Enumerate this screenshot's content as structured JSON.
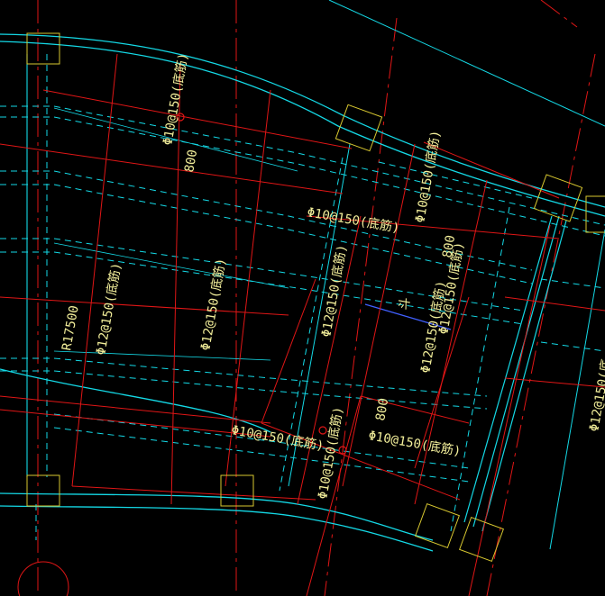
{
  "drawing": {
    "background": "#000000",
    "colors": {
      "wall": "#14d9e6",
      "rebar": "#e01616",
      "text": "#f2ee9a",
      "column_hatch": "#d8c830",
      "highlight": "#4060ff"
    },
    "labels": {
      "rebar_a": "Φ10@150(底筋)",
      "rebar_b": "Φ12@150(底筋)",
      "rebar_c": "Φ12@150(底筋)",
      "rebar_d": "Φ10@150(底筋)",
      "rebar_e": "Φ12@150(底筋)",
      "rebar_f": "Φ10@150(底筋)",
      "rebar_g": "Φ10@150(底筋)",
      "rebar_h": "Φ10@150(底筋)",
      "rebar_i": "Φ12@150(底筋)",
      "rebar_j": "Φ12@150(底",
      "rebar_k": "Φ10@150(底筋)",
      "rebar_l": "Φ12@150(底筋)",
      "len_a": "800",
      "len_b": "800",
      "len_c": "800",
      "radius": "R17500",
      "side_mark": "斗"
    }
  }
}
